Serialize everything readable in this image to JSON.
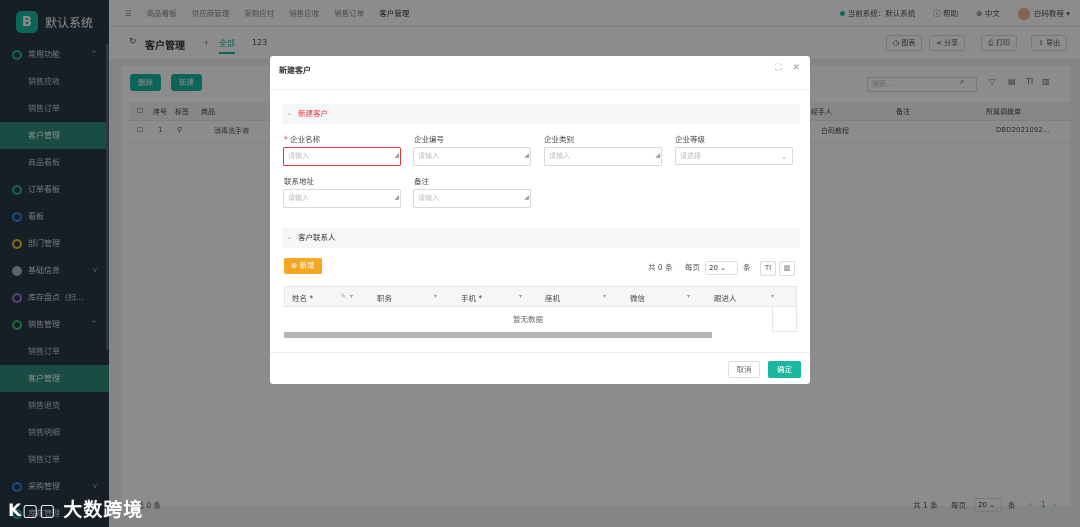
{
  "app": {
    "title": "默认系统"
  },
  "sidebar": {
    "items": [
      {
        "label": "常用功能",
        "type": "group"
      },
      {
        "label": "销售应收",
        "type": "sub"
      },
      {
        "label": "销售订单",
        "type": "sub"
      },
      {
        "label": "客户管理",
        "type": "sub",
        "active": true
      },
      {
        "label": "商品看板",
        "type": "sub"
      },
      {
        "label": "订单看板",
        "type": "top"
      },
      {
        "label": "看板",
        "type": "top"
      },
      {
        "label": "部门管理",
        "type": "top"
      },
      {
        "label": "基础信息",
        "type": "top"
      },
      {
        "label": "库存盘点（扫...",
        "type": "top"
      },
      {
        "label": "销售管理",
        "type": "group"
      },
      {
        "label": "销售订单",
        "type": "sub"
      },
      {
        "label": "客户管理",
        "type": "sub",
        "active": true
      },
      {
        "label": "销售退货",
        "type": "sub"
      },
      {
        "label": "销售明细",
        "type": "sub"
      },
      {
        "label": "销售订单",
        "type": "sub"
      },
      {
        "label": "采购管理",
        "type": "top"
      },
      {
        "label": "库存管理",
        "type": "top"
      }
    ]
  },
  "topbar": {
    "crumbs": [
      "商品看板",
      "供应商管理",
      "采购应付",
      "销售应收",
      "销售订单",
      "客户管理"
    ],
    "current_system": "当前系统：默认系统",
    "help": "帮助",
    "lang": "中文",
    "user": "白码教程"
  },
  "subbar": {
    "title": "客户管理",
    "tab_all": "全部",
    "tab_count": "123",
    "chart": "图表",
    "share": "分享",
    "print": "打印",
    "export": "导出"
  },
  "content": {
    "delete": "删除",
    "create": "新建",
    "search_placeholder": "搜索...",
    "cols": [
      "序号",
      "标签",
      "商品",
      "经手人",
      "备注",
      "所属调拨单"
    ],
    "row": {
      "no": "1",
      "product": "消毒洗手液",
      "handler": "白码教程",
      "order": "DBD2021092..."
    },
    "selected": "已选 0 条",
    "total_pre": "共",
    "total_num": "1",
    "total_suf": "条",
    "per_page": "每页",
    "page_size": "20",
    "page_unit": "条",
    "page_num": "1"
  },
  "modal": {
    "title": "新建客户",
    "section1": "新建客户",
    "fields": {
      "name_label": "企业名称",
      "code_label": "企业编号",
      "type_label": "企业类别",
      "level_label": "企业等级",
      "address_label": "联系地址",
      "remark_label": "备注",
      "input_placeholder": "请输入",
      "select_placeholder": "请选择"
    },
    "section2": "客户联系人",
    "add_button": "新增",
    "pager": {
      "total_pre": "共",
      "total_num": "0",
      "total_suf": "条",
      "per_page": "每页",
      "size": "20",
      "unit": "条"
    },
    "columns": [
      "姓名 *",
      "职务",
      "手机 *",
      "座机",
      "微信",
      "跟进人"
    ],
    "empty": "暂无数据",
    "cancel": "取消",
    "confirm": "确定"
  },
  "watermark": {
    "text": "大数跨境"
  }
}
